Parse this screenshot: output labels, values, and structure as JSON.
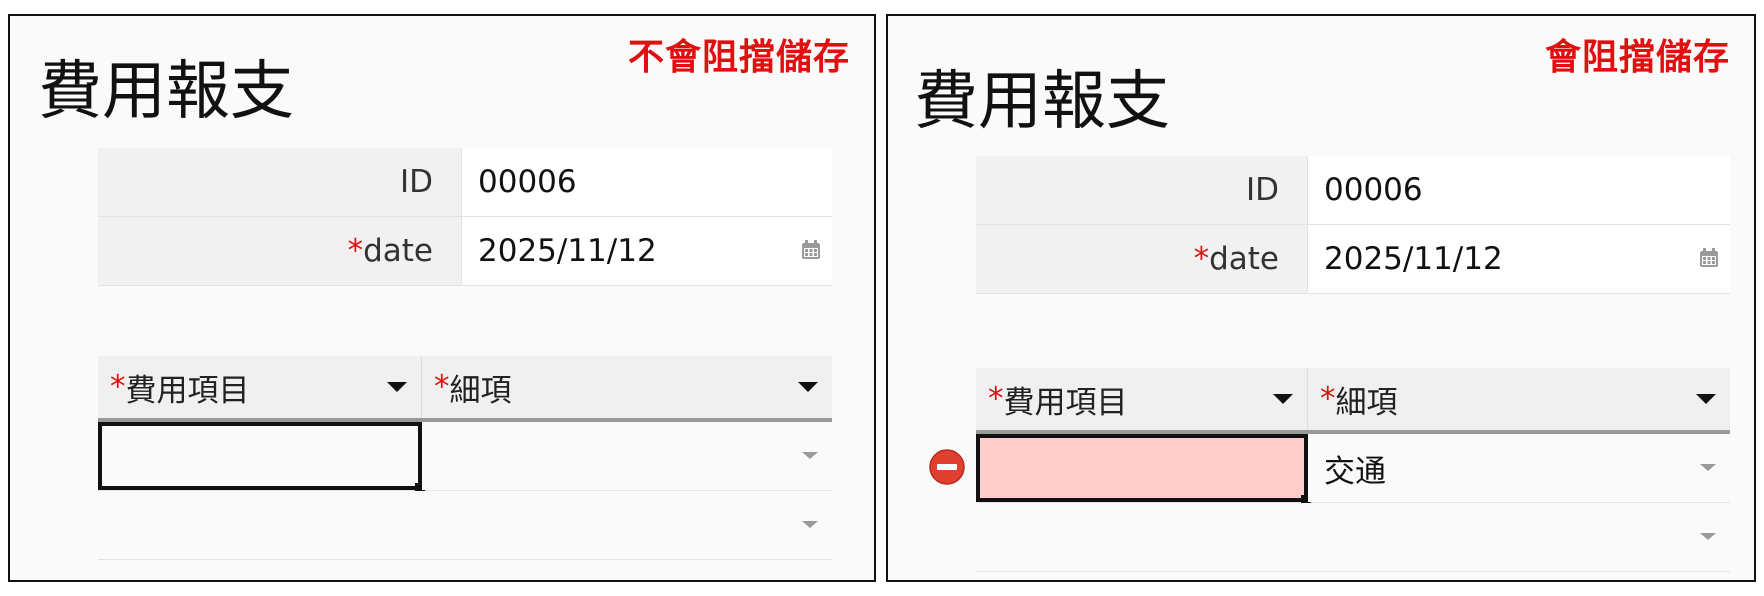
{
  "panels": {
    "left": {
      "caption": "不會阻擋儲存",
      "title": "費用報支",
      "fields": {
        "id": {
          "label": "ID",
          "value": "00006"
        },
        "date": {
          "required_mark": "*",
          "label": "date",
          "value": "2025/11/12"
        }
      },
      "grid": {
        "columns": [
          {
            "required_mark": "*",
            "label": "費用項目"
          },
          {
            "required_mark": "*",
            "label": "細項"
          }
        ],
        "rows": [
          {
            "item": "",
            "detail": ""
          },
          {
            "item": "",
            "detail": ""
          }
        ]
      }
    },
    "right": {
      "caption": "會阻擋儲存",
      "title": "費用報支",
      "fields": {
        "id": {
          "label": "ID",
          "value": "00006"
        },
        "date": {
          "required_mark": "*",
          "label": "date",
          "value": "2025/11/12"
        }
      },
      "grid": {
        "columns": [
          {
            "required_mark": "*",
            "label": "費用項目"
          },
          {
            "required_mark": "*",
            "label": "細項"
          }
        ],
        "rows": [
          {
            "item": "",
            "detail": "交通"
          },
          {
            "item": "",
            "detail": ""
          }
        ]
      }
    }
  },
  "icons": {
    "calendar": "calendar-icon",
    "dropdown": "chevron-down-icon",
    "error": "error-icon"
  },
  "colors": {
    "caption": "#e01010",
    "required": "#e01010",
    "error_cell": "#ffcccc",
    "error_icon": "#e0402f"
  }
}
